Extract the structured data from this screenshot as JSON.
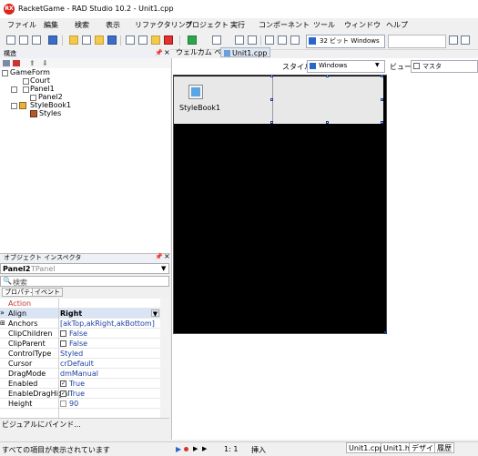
{
  "window": {
    "title": "RacketGame - RAD Studio 10.2 - Unit1.cpp"
  },
  "menu": [
    "ファイル",
    "編集",
    "検索",
    "表示",
    "リファクタリング",
    "プロジェクト",
    "実行",
    "コンポーネント",
    "ツール",
    "ウィンドウ",
    "ヘルプ"
  ],
  "toolbar": {
    "platform": "32 ビット Windows",
    "config": ""
  },
  "structure": {
    "title": "構造",
    "tree": [
      {
        "label": "GameForm",
        "level": 0
      },
      {
        "label": "Court",
        "level": 1
      },
      {
        "label": "Panel1",
        "level": 1
      },
      {
        "label": "Panel2",
        "level": 2
      },
      {
        "label": "StyleBook1",
        "level": 1
      },
      {
        "label": "Styles",
        "level": 2
      }
    ]
  },
  "inspector": {
    "title": "オブジェクト インスペクタ",
    "object_name": "Panel2",
    "object_type": "TPanel",
    "search_placeholder": "検索",
    "tabs": [
      "プロパティ",
      "イベント"
    ],
    "properties": [
      {
        "name": "Action",
        "value": ""
      },
      {
        "name": "Align",
        "value": "Right"
      },
      {
        "name": "Anchors",
        "value": "[akTop,akRight,akBottom]"
      },
      {
        "name": "ClipChildren",
        "value": "False"
      },
      {
        "name": "ClipParent",
        "value": "False"
      },
      {
        "name": "ControlType",
        "value": "Styled"
      },
      {
        "name": "Cursor",
        "value": "crDefault"
      },
      {
        "name": "DragMode",
        "value": "dmManual"
      },
      {
        "name": "Enabled",
        "value": "True"
      },
      {
        "name": "EnableDragHighl",
        "value": "True"
      },
      {
        "name": "Height",
        "value": "90"
      }
    ],
    "bottom_text": "ビジュアルにバインド..."
  },
  "designer": {
    "tabs": [
      "ウェルカム ページ",
      "Unit1.cpp"
    ],
    "style_label": "スタイル:",
    "style_value": "Windows",
    "view_label": "ビュー:",
    "view_value": "マスタ",
    "component_caption": "StyleBook1"
  },
  "status": {
    "message": "すべての項目が表示されています",
    "position": "1:   1",
    "mode": "挿入",
    "tabs": [
      "Unit1.cpp",
      "Unit1.h",
      "デザイン",
      "履歴"
    ]
  }
}
